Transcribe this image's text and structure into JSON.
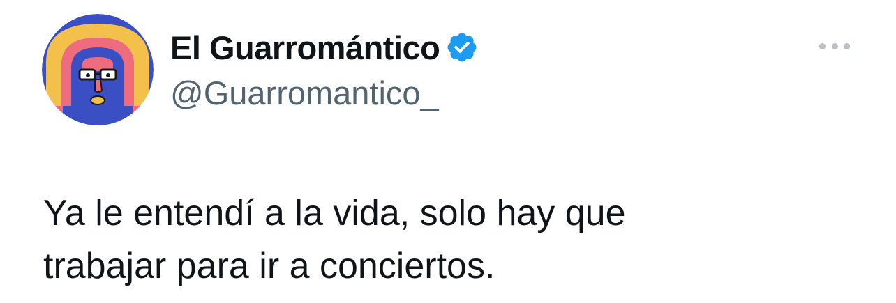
{
  "tweet": {
    "author": {
      "display_name": "El Guarromántico",
      "handle": "@Guarromantico_",
      "verified": true,
      "verified_icon": "verified-badge-icon",
      "avatar_icon": "bearded-face-avatar"
    },
    "more_icon": "more-options-icon",
    "text_line_1": "Ya le entendí a la vida, solo hay que",
    "text_line_2": "trabajar para ir a conciertos."
  },
  "colors": {
    "text_primary": "#0f1419",
    "text_secondary": "#536471",
    "verified_blue": "#1d9bf0",
    "more_dots": "#b9c1c8",
    "avatar_blue": "#3b4fc4",
    "avatar_yellow": "#f3c14b",
    "avatar_pink": "#ef6c7f"
  }
}
